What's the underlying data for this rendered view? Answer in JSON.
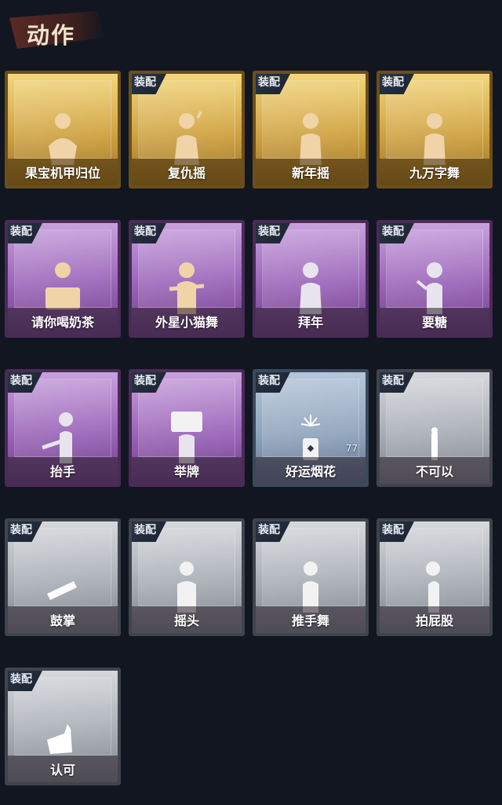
{
  "header": {
    "title": "动作"
  },
  "equipped_tag": "装配",
  "colors": {
    "gold": "#cfa241",
    "purple": "#9a64b8",
    "blue": "#8fa4bc",
    "gray": "#a8adb5"
  },
  "cards": [
    {
      "name": "果宝机甲归位",
      "rarity": "gold",
      "equipped": false
    },
    {
      "name": "复仇摇",
      "rarity": "gold",
      "equipped": true
    },
    {
      "name": "新年摇",
      "rarity": "gold",
      "equipped": true
    },
    {
      "name": "九万字舞",
      "rarity": "gold",
      "equipped": true
    },
    {
      "name": "请你喝奶茶",
      "rarity": "purple",
      "equipped": true
    },
    {
      "name": "外星小猫舞",
      "rarity": "purple",
      "equipped": true
    },
    {
      "name": "拜年",
      "rarity": "purple",
      "equipped": true
    },
    {
      "name": "要糖",
      "rarity": "purple",
      "equipped": true
    },
    {
      "name": "抬手",
      "rarity": "purple",
      "equipped": true
    },
    {
      "name": "举牌",
      "rarity": "purple",
      "equipped": true
    },
    {
      "name": "好运烟花",
      "rarity": "blue",
      "equipped": true,
      "count": "77"
    },
    {
      "name": "不可以",
      "rarity": "gray",
      "equipped": true
    },
    {
      "name": "鼓掌",
      "rarity": "gray",
      "equipped": true
    },
    {
      "name": "摇头",
      "rarity": "gray",
      "equipped": true
    },
    {
      "name": "推手舞",
      "rarity": "gray",
      "equipped": true
    },
    {
      "name": "拍屁股",
      "rarity": "gray",
      "equipped": true
    },
    {
      "name": "认可",
      "rarity": "gray",
      "equipped": true
    }
  ]
}
